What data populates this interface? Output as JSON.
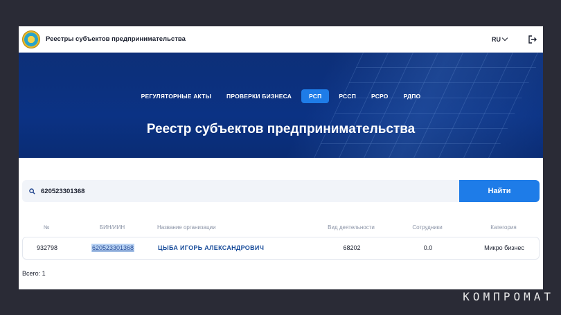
{
  "header": {
    "app_title": "Реестры субъектов предпринимательства",
    "lang": "RU"
  },
  "nav": {
    "items": [
      {
        "label": "РЕГУЛЯТОРНЫЕ АКТЫ"
      },
      {
        "label": "ПРОВЕРКИ БИЗНЕСА"
      },
      {
        "label": "РСП"
      },
      {
        "label": "РССП"
      },
      {
        "label": "РСРО"
      },
      {
        "label": "РДПО"
      }
    ],
    "active": "РСП"
  },
  "hero": {
    "title": "Реестр субъектов предпринимательства"
  },
  "search": {
    "value": "620523301368",
    "button_label": "Найти"
  },
  "table": {
    "columns": [
      "№",
      "БИН/ИИН",
      "Название организации",
      "Вид деятельности",
      "Сотрудники",
      "Категория"
    ],
    "rows": [
      {
        "num": "932798",
        "bin": "620523301368",
        "name": "ЦЫБА ИГОРЬ АЛЕКСАНДРОВИЧ",
        "activity": "68202",
        "employees": "0.0",
        "category": "Микро бизнес"
      }
    ]
  },
  "total": "Всего: 1",
  "watermark": "КОМПРОМАТ",
  "colors": {
    "accent": "#1e7ce8",
    "hero": "#0b3284",
    "link": "#1b4e9b"
  }
}
